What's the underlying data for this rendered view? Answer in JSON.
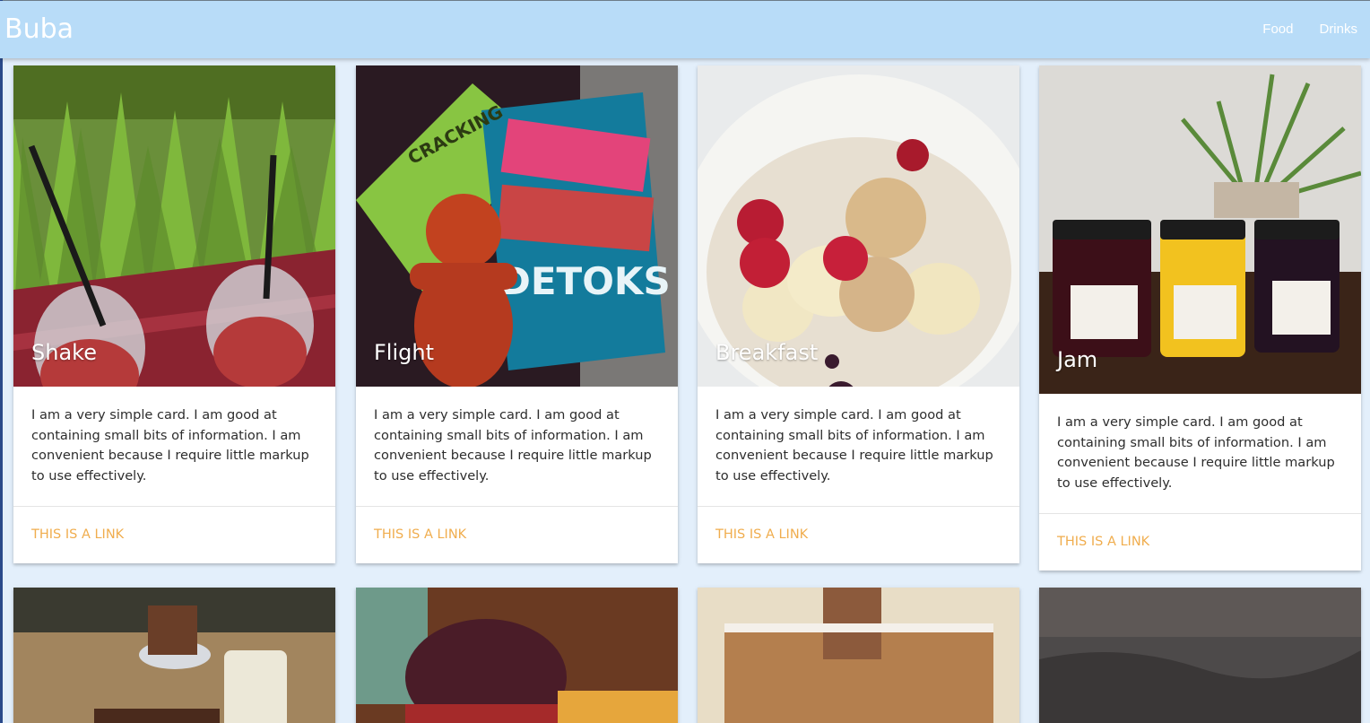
{
  "navbar": {
    "brand": "Buba",
    "links": [
      "Food",
      "Drinks"
    ]
  },
  "cards": [
    {
      "title": "Shake",
      "text": "I am a very simple card. I am good at containing small bits of information. I am convenient because I require little markup to use effectively.",
      "link": "THIS IS A LINK"
    },
    {
      "title": "Flight",
      "text": "I am a very simple card. I am good at containing small bits of information. I am convenient because I require little markup to use effectively.",
      "link": "THIS IS A LINK"
    },
    {
      "title": "Breakfast",
      "text": "I am a very simple card. I am good at containing small bits of information. I am convenient because I require little markup to use effectively.",
      "link": "THIS IS A LINK"
    },
    {
      "title": "Jam",
      "text": "I am a very simple card. I am good at containing small bits of information. I am convenient because I require little markup to use effectively.",
      "link": "THIS IS A LINK"
    }
  ],
  "colors": {
    "navbar": "#b8dcf8",
    "background": "#e3effb",
    "link": "#f0ad4e"
  }
}
